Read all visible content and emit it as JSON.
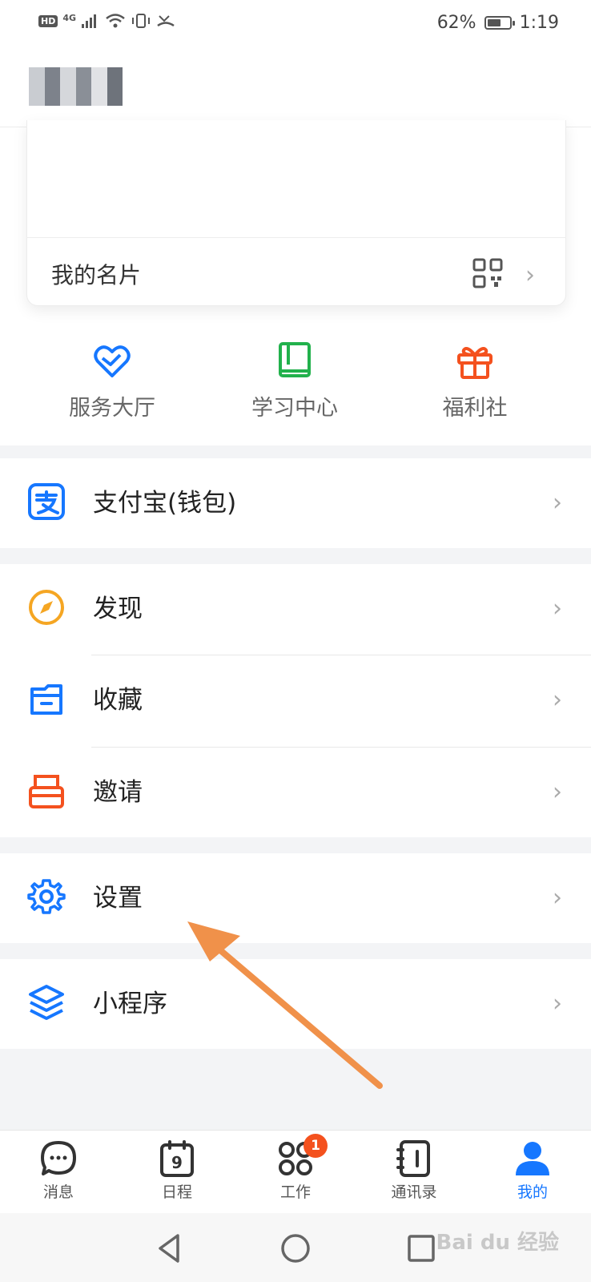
{
  "status_bar": {
    "network": "4G",
    "hd_label": "HD",
    "battery_percent": "62%",
    "battery_level": 0.62,
    "time": "1:19"
  },
  "profile_card": {
    "title": "我的名片"
  },
  "quick_actions": [
    {
      "label": "服务大厅",
      "icon": "heart-hand-icon",
      "color": "#1677ff"
    },
    {
      "label": "学习中心",
      "icon": "book-icon",
      "color": "#22b14c"
    },
    {
      "label": "福利社",
      "icon": "gift-icon",
      "color": "#f4511e"
    }
  ],
  "menu": {
    "alipay": "支付宝(钱包)",
    "discover": "发现",
    "favorites": "收藏",
    "invite": "邀请",
    "settings": "设置",
    "mini_programs": "小程序"
  },
  "bottom_nav": [
    {
      "label": "消息",
      "icon": "chat-icon"
    },
    {
      "label": "日程",
      "icon": "calendar-icon",
      "day": "9"
    },
    {
      "label": "工作",
      "icon": "workbench-icon",
      "badge": "1"
    },
    {
      "label": "通讯录",
      "icon": "contacts-icon"
    },
    {
      "label": "我的",
      "icon": "profile-icon",
      "active": true
    }
  ],
  "watermark": "Bai du 经验",
  "colors": {
    "accent": "#1677ff",
    "gap": "#f3f4f6",
    "annotation_arrow": "#f0914a"
  }
}
